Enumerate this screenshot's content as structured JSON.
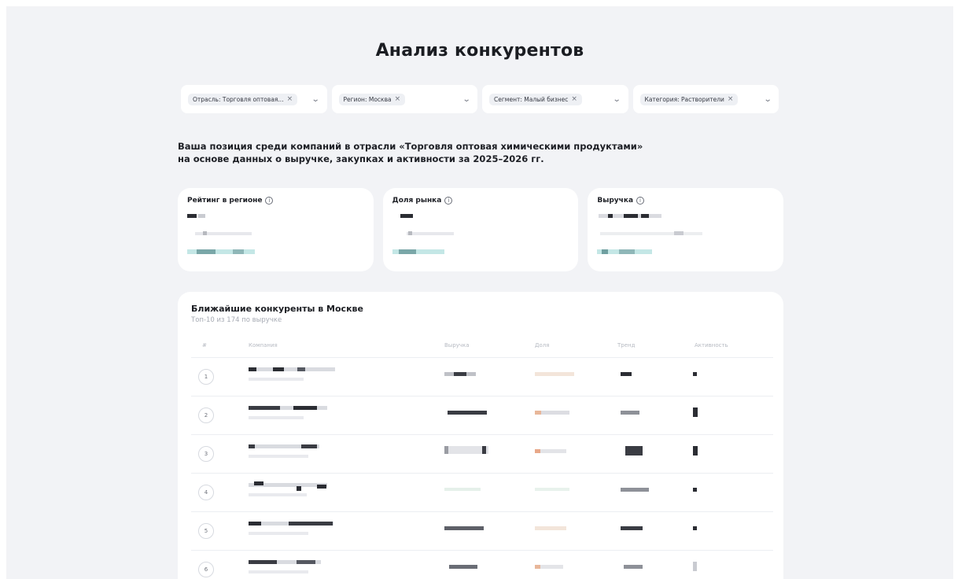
{
  "page": {
    "title": "Анализ конкурентов",
    "intro_line1": "Ваша позиция среди компаний в отрасли «Торговля оптовая химическими продуктами»",
    "intro_line2": "на основе данных о выручке, закупках и активности за 2025–2026 гг."
  },
  "filters": [
    {
      "chip": "Отрасль: Торговля оптовая...",
      "remove": "×",
      "chevron": "⌄"
    },
    {
      "chip": "Регион: Москва",
      "remove": "×",
      "chevron": "⌄"
    },
    {
      "chip": "Сегмент: Малый бизнес",
      "remove": "×",
      "chevron": "⌄"
    },
    {
      "chip": "Категория: Растворители",
      "remove": "×",
      "chevron": "⌄"
    }
  ],
  "cards": [
    {
      "title": "Рейтинг в регионе",
      "info": "i"
    },
    {
      "title": "Доля рынка",
      "info": "i"
    },
    {
      "title": "Выручка",
      "info": "i"
    }
  ],
  "competitors": {
    "title": "Ближайшие конкуренты в Москве",
    "subtitle": "Топ-10 из 174 по выручке",
    "columns": [
      "#",
      "Компания",
      "Выручка",
      "Доля",
      "Тренд",
      "Активность"
    ],
    "ranks": [
      "1",
      "2",
      "3",
      "4",
      "5",
      "6"
    ]
  },
  "colors": {
    "background": "#f2f3f6",
    "card": "#ffffff",
    "redacted_dark": "#2b2d33",
    "redacted_teal": "#bfe6e4"
  }
}
